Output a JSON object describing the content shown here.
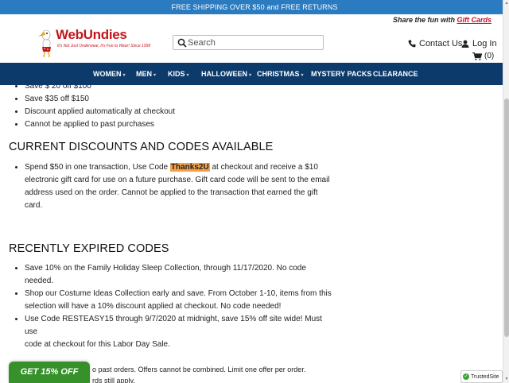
{
  "topbar": {
    "text": "FREE SHIPPING OVER $50 and FREE RETURNS"
  },
  "header": {
    "share_text": "Share the fun with ",
    "share_link": "Gift Cards",
    "logo_name": "WebUndies",
    "logo_tagline": "It's Not Just Underwear, It's Fun to Wear! Since 1999",
    "search_placeholder": "Search",
    "contact_label": "Contact Us",
    "login_label": "Log In",
    "cart_count": "(0)"
  },
  "nav": {
    "items": [
      {
        "label": "WOMEN",
        "caret": "▾"
      },
      {
        "label": "MEN",
        "caret": "▾"
      },
      {
        "label": "KIDS",
        "caret": "▾"
      },
      {
        "label": "HALLOWEEN",
        "caret": "▾"
      },
      {
        "label": "CHRISTMAS",
        "caret": "▾"
      },
      {
        "label": "MYSTERY PACKS",
        "caret": ""
      },
      {
        "label": "CLEARANCE",
        "caret": ""
      }
    ]
  },
  "content": {
    "top_list": [
      "Save $ 20 off $100",
      "Save $35 off $150",
      "Discount applied automatically at checkout",
      "Cannot be applied to past purchases"
    ],
    "current_heading": "CURRENT DISCOUNTS AND CODES AVAILABLE",
    "current_item": {
      "before": "Spend $50 in one transaction, Use Code ",
      "code": "Thanks2U",
      "after_line1": " at checkout and receive a $10",
      "line2": "electronic gift card for use on a future purchase.  Gift card code will be sent to the email",
      "line3": "address used on the order.  Cannot be applied to the transaction that earned the gift",
      "line4": "card."
    },
    "expired_heading": "RECENTLY EXPIRED CODES",
    "expired_items": [
      {
        "line1": "Save 10% on the Family Holiday Sleep Collection, through 11/17/2020.  No code",
        "line2": "needed."
      },
      {
        "line1": "Shop our Costume Ideas Collection early and save.  From October 1-10, items from this",
        "line2": "selection will have a 10% discount applied at checkout.  No code needed!"
      },
      {
        "line1": "Use Code RESTEASY15 through 9/7/2020 at midnight, save 15% off site wide!  Must use",
        "line2": "code at checkout for this Labor Day Sale."
      }
    ],
    "bottom_line1": "o past orders.  Offers cannot be combined.  Limit one offer per order.",
    "bottom_line2": "rds still apply."
  },
  "promo": {
    "label": "GET 15% OFF"
  },
  "trusted": {
    "label": "TrustedSite"
  },
  "colors": {
    "topbar": "#2b7bc0",
    "nav": "#0c3a6b",
    "brand_red": "#c4161c",
    "promo_green": "#36912a",
    "code_highlight": "#f5a04a"
  }
}
